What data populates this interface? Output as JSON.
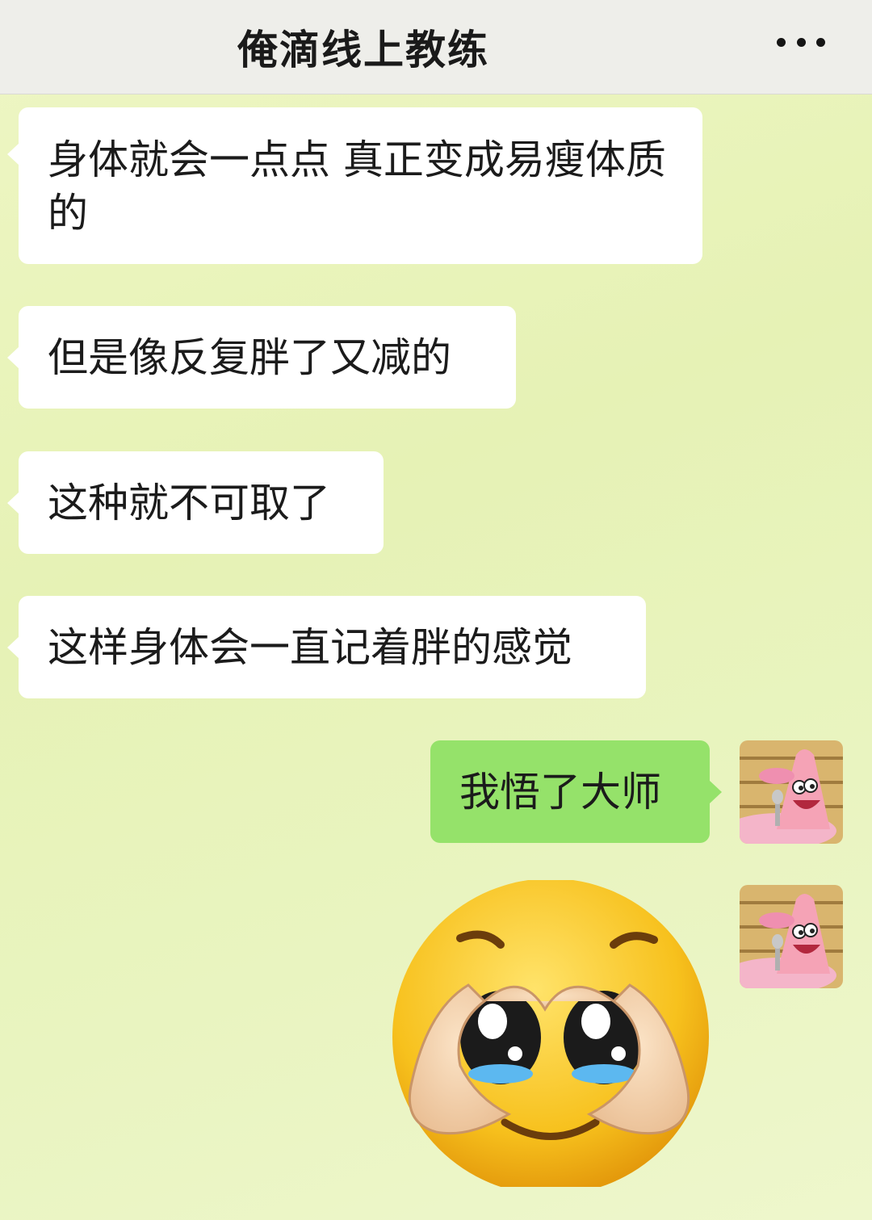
{
  "header": {
    "title": "俺滴线上教练",
    "more_icon": "more-dots-icon"
  },
  "messages": [
    {
      "sender": "other",
      "text": "身体就会一点点 真正变成易瘦体质的"
    },
    {
      "sender": "other",
      "text": "但是像反复胖了又减的"
    },
    {
      "sender": "other",
      "text": "这种就不可取了"
    },
    {
      "sender": "other",
      "text": "这样身体会一直记着胖的感觉"
    },
    {
      "sender": "me",
      "text": "我悟了大师"
    },
    {
      "sender": "me",
      "sticker": "pleading-face-heart-hands-emoji"
    }
  ],
  "colors": {
    "my_bubble": "#95e26a",
    "other_bubble": "#ffffff",
    "header_bg": "#eeeeea",
    "chat_bg": "#e8f3b8"
  }
}
